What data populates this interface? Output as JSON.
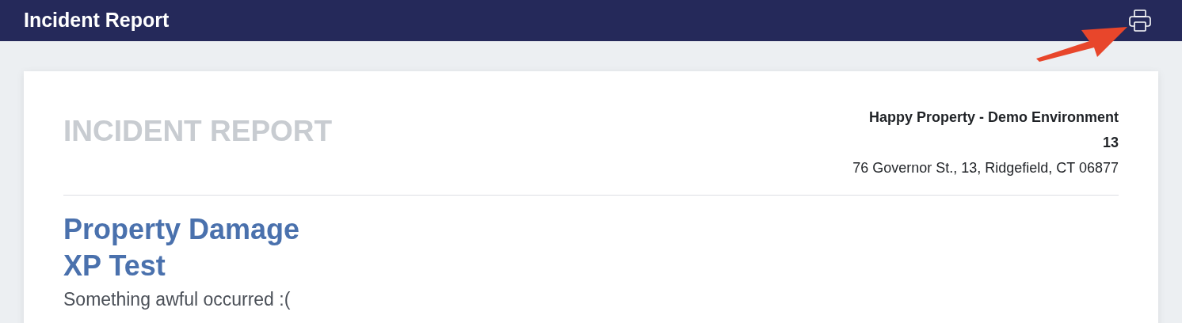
{
  "header": {
    "title": "Incident Report"
  },
  "report": {
    "heading": "INCIDENT REPORT",
    "property_name": "Happy Property - Demo Environment",
    "unit": "13",
    "address": "76 Governor St., 13, Ridgefield, CT 06877",
    "incident_type": "Property Damage",
    "incident_title": "XP Test",
    "description": "Something awful occurred :("
  }
}
